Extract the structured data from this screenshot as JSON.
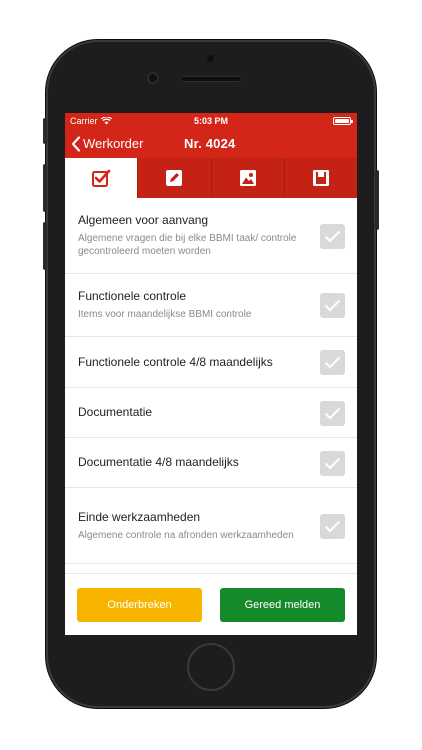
{
  "status_bar": {
    "carrier": "Carrier",
    "time": "5:03 PM"
  },
  "nav": {
    "back_label": "Werkorder",
    "title": "Nr. 4024"
  },
  "tabs": [
    {
      "icon": "checklist-icon",
      "active": true
    },
    {
      "icon": "edit-icon",
      "active": false
    },
    {
      "icon": "image-icon",
      "active": false
    },
    {
      "icon": "save-icon",
      "active": false
    }
  ],
  "items": [
    {
      "title": "Algemeen voor aanvang",
      "subtitle": "Algemene vragen die bij elke BBMI taak/ controle gecontroleerd moeten worden"
    },
    {
      "title": "Functionele controle",
      "subtitle": "Items voor maandelijkse BBMI controle"
    },
    {
      "title": "Functionele controle 4/8 maandelijks",
      "subtitle": ""
    },
    {
      "title": "Documentatie",
      "subtitle": ""
    },
    {
      "title": "Documentatie 4/8 maandelijks",
      "subtitle": ""
    },
    {
      "title": "Einde werkzaamheden",
      "subtitle": "Algemene controle na afronden werkzaamheden"
    }
  ],
  "footer": {
    "pause_label": "Onderbreken",
    "done_label": "Gereed melden"
  },
  "colors": {
    "primary": "#d32518",
    "pause": "#f7b500",
    "done": "#148a2a",
    "check_bg": "#d9d9d9"
  }
}
